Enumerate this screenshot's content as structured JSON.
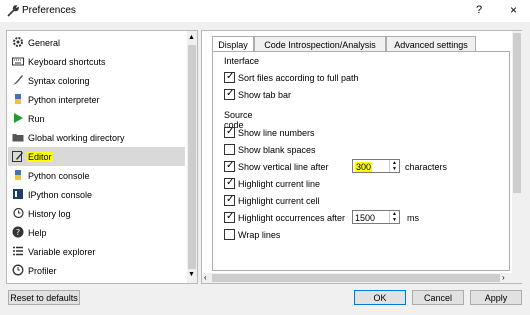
{
  "window": {
    "title": "Preferences",
    "help": "?",
    "close": "×"
  },
  "sidebar": {
    "items": [
      {
        "label": "General",
        "icon": "gear-icon"
      },
      {
        "label": "Keyboard shortcuts",
        "icon": "keyboard-icon"
      },
      {
        "label": "Syntax coloring",
        "icon": "paint-brush-icon"
      },
      {
        "label": "Python interpreter",
        "icon": "python-icon"
      },
      {
        "label": "Run",
        "icon": "run-icon"
      },
      {
        "label": "Global working directory",
        "icon": "folder-icon"
      },
      {
        "label": "Editor",
        "icon": "editor-icon",
        "selected": true
      },
      {
        "label": "Python console",
        "icon": "python-console-icon"
      },
      {
        "label": "IPython console",
        "icon": "ipython-console-icon"
      },
      {
        "label": "History log",
        "icon": "history-icon"
      },
      {
        "label": "Help",
        "icon": "help-icon"
      },
      {
        "label": "Variable explorer",
        "icon": "list-icon"
      },
      {
        "label": "Profiler",
        "icon": "profiler-icon"
      }
    ]
  },
  "tabs": [
    "Display",
    "Code Introspection/Analysis",
    "Advanced settings"
  ],
  "interface": {
    "title": "Interface",
    "options": [
      {
        "label": "Sort files according to full path",
        "checked": true
      },
      {
        "label": "Show tab bar",
        "checked": true
      }
    ]
  },
  "source_code": {
    "title": "Source code",
    "options": [
      {
        "label": "Show line numbers",
        "checked": true
      },
      {
        "label": "Show blank spaces",
        "checked": false
      },
      {
        "label": "Show vertical line after",
        "checked": true
      },
      {
        "label": "Highlight current line",
        "checked": true
      },
      {
        "label": "Highlight current cell",
        "checked": true
      },
      {
        "label": "Highlight occurrences after",
        "checked": true
      },
      {
        "label": "Wrap lines",
        "checked": false
      }
    ],
    "vertical_line_value": "300",
    "vertical_line_suffix": "characters",
    "occurrences_value": "1500",
    "occurrences_suffix": "ms"
  },
  "buttons": {
    "reset": "Reset to defaults",
    "ok": "OK",
    "cancel": "Cancel",
    "apply": "Apply"
  },
  "colors": {
    "highlight": "#ffff00",
    "accent": "#0078d7"
  }
}
